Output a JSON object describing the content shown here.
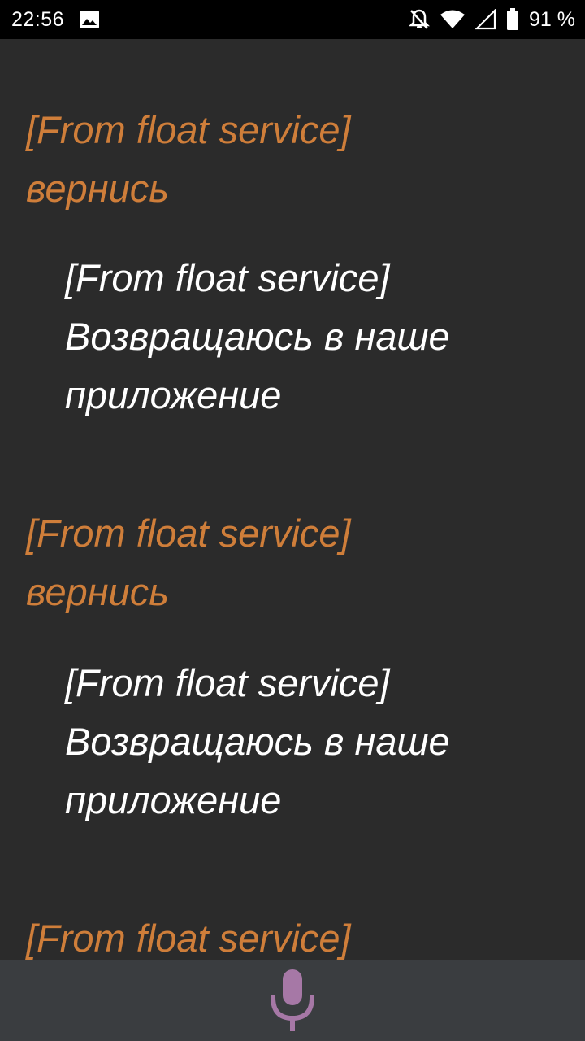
{
  "status_bar": {
    "time": "22:56",
    "battery": "91 %",
    "icons": [
      "image-icon",
      "notifications-off-icon",
      "wifi-icon",
      "signal-icon",
      "battery-icon"
    ]
  },
  "conversation": {
    "messages": [
      {
        "role": "user",
        "text": "[From float service]\nвернись"
      },
      {
        "role": "assistant",
        "text": "[From float service]\nВозвращаюсь в наше\nприложение"
      },
      {
        "role": "user",
        "text": "[From float service]\nвернись"
      },
      {
        "role": "assistant",
        "text": "[From float service]\nВозвращаюсь в наше\nприложение"
      },
      {
        "role": "user",
        "text": "[From float service]"
      }
    ]
  },
  "input": {
    "mic_icon": "mic-icon"
  },
  "colors": {
    "background": "#2b2b2b",
    "user_text": "#cf7e3a",
    "reply_text": "#ffffff",
    "bottom_bar": "#3a3d40",
    "mic": "#a678a6"
  }
}
